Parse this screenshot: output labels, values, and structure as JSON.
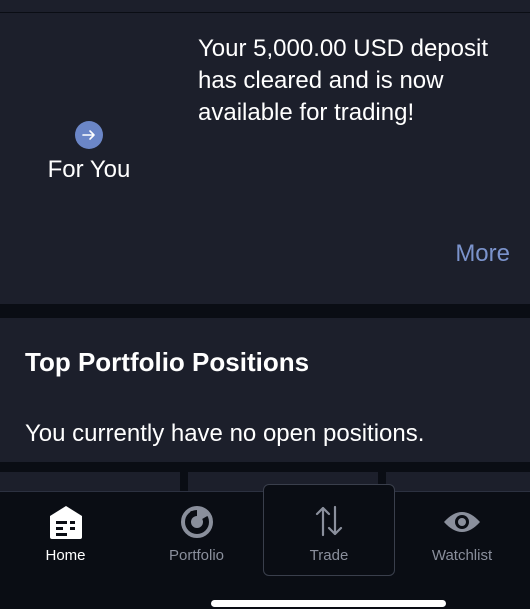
{
  "for_you": {
    "label": "For You",
    "message": "Your 5,000.00 USD deposit has cleared and is now available for trading!",
    "more_label": "More"
  },
  "positions": {
    "title": "Top Portfolio Positions",
    "empty_text": "You currently have no open positions."
  },
  "tabbar": {
    "tabs": [
      {
        "label": "Home",
        "icon": "home-icon",
        "active": true
      },
      {
        "label": "Portfolio",
        "icon": "portfolio-icon",
        "active": false
      },
      {
        "label": "Trade",
        "icon": "trade-icon",
        "active": false
      },
      {
        "label": "Watchlist",
        "icon": "eye-icon",
        "active": false
      }
    ]
  },
  "colors": {
    "background": "#0a0d14",
    "card": "#1c1f2b",
    "accent": "#7b93cc",
    "arrow_circle": "#6b86c7",
    "inactive_text": "#8a8f9c"
  }
}
